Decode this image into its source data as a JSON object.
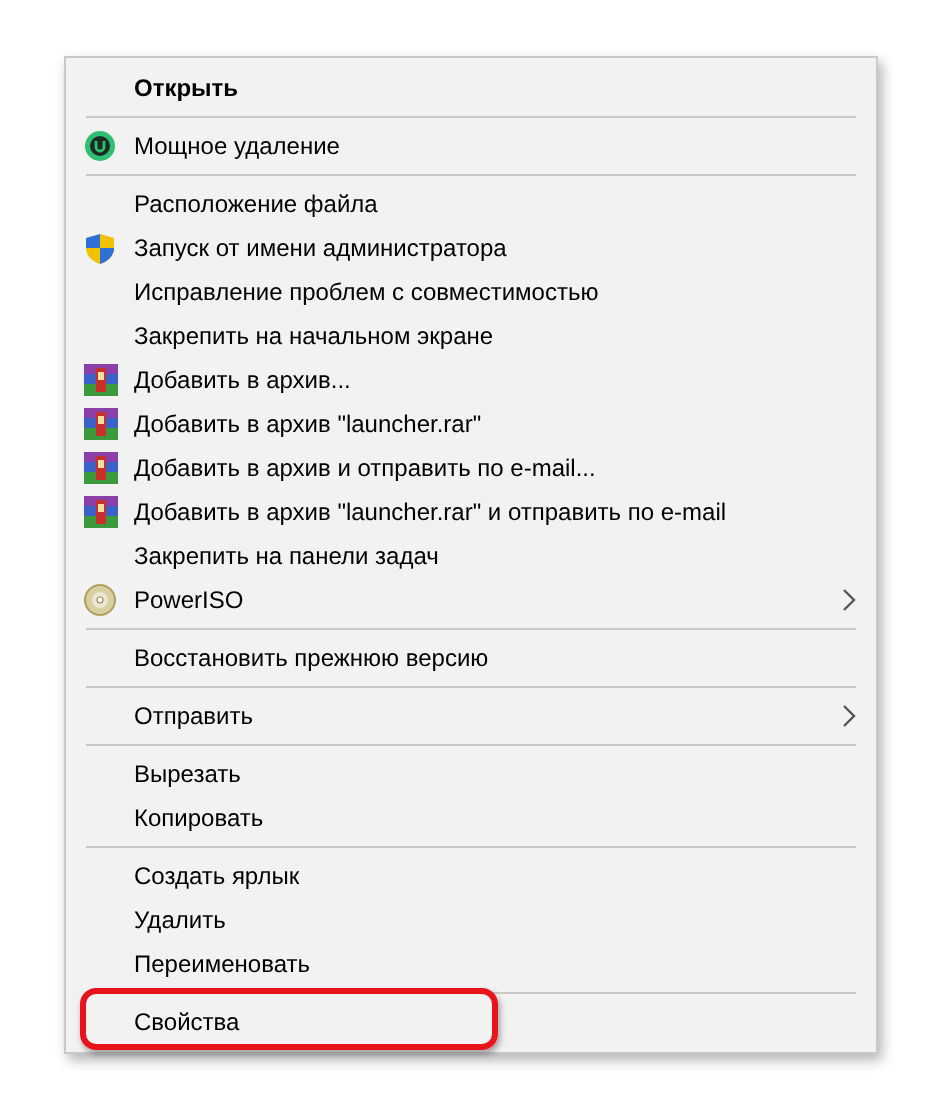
{
  "menu": {
    "groups": [
      {
        "items": [
          {
            "label": "Открыть",
            "kind": "plain",
            "default": true,
            "submenu": false,
            "highlighted": false
          }
        ]
      },
      {
        "items": [
          {
            "label": "Мощное удаление",
            "kind": "uninstaller",
            "default": false,
            "submenu": false,
            "highlighted": false
          }
        ]
      },
      {
        "items": [
          {
            "label": "Расположение файла",
            "kind": "plain",
            "default": false,
            "submenu": false,
            "highlighted": false
          },
          {
            "label": "Запуск от имени администратора",
            "kind": "shield",
            "default": false,
            "submenu": false,
            "highlighted": false
          },
          {
            "label": "Исправление проблем с совместимостью",
            "kind": "plain",
            "default": false,
            "submenu": false,
            "highlighted": false
          },
          {
            "label": "Закрепить на начальном экране",
            "kind": "plain",
            "default": false,
            "submenu": false,
            "highlighted": false
          },
          {
            "label": "Добавить в архив...",
            "kind": "archive",
            "default": false,
            "submenu": false,
            "highlighted": false
          },
          {
            "label": "Добавить в архив \"launcher.rar\"",
            "kind": "archive",
            "default": false,
            "submenu": false,
            "highlighted": false
          },
          {
            "label": "Добавить в архив и отправить по e-mail...",
            "kind": "archive",
            "default": false,
            "submenu": false,
            "highlighted": false
          },
          {
            "label": "Добавить в архив \"launcher.rar\" и отправить по e-mail",
            "kind": "archive",
            "default": false,
            "submenu": false,
            "highlighted": false
          },
          {
            "label": "Закрепить на панели задач",
            "kind": "plain",
            "default": false,
            "submenu": false,
            "highlighted": false
          },
          {
            "label": "PowerISO",
            "kind": "disc",
            "default": false,
            "submenu": true,
            "highlighted": false
          }
        ]
      },
      {
        "items": [
          {
            "label": "Восстановить прежнюю версию",
            "kind": "plain",
            "default": false,
            "submenu": false,
            "highlighted": false
          }
        ]
      },
      {
        "items": [
          {
            "label": "Отправить",
            "kind": "plain",
            "default": false,
            "submenu": true,
            "highlighted": false
          }
        ]
      },
      {
        "items": [
          {
            "label": "Вырезать",
            "kind": "plain",
            "default": false,
            "submenu": false,
            "highlighted": false
          },
          {
            "label": "Копировать",
            "kind": "plain",
            "default": false,
            "submenu": false,
            "highlighted": false
          }
        ]
      },
      {
        "items": [
          {
            "label": "Создать ярлык",
            "kind": "plain",
            "default": false,
            "submenu": false,
            "highlighted": false
          },
          {
            "label": "Удалить",
            "kind": "plain",
            "default": false,
            "submenu": false,
            "highlighted": false
          },
          {
            "label": "Переименовать",
            "kind": "plain",
            "default": false,
            "submenu": false,
            "highlighted": false
          }
        ]
      },
      {
        "items": [
          {
            "label": "Свойства",
            "kind": "plain",
            "default": false,
            "submenu": false,
            "highlighted": true
          }
        ]
      }
    ]
  }
}
